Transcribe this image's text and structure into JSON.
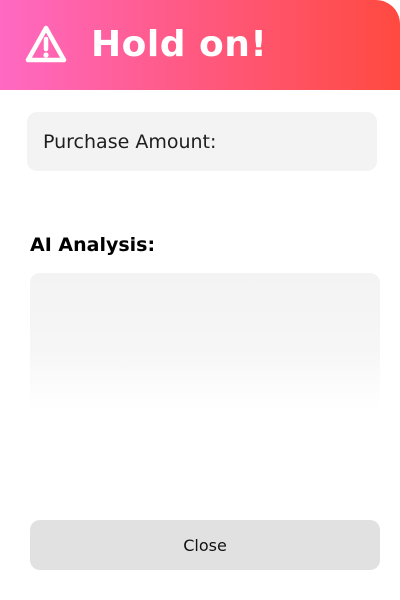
{
  "header": {
    "title": "Hold on!",
    "icon": "warning-triangle-icon",
    "gradient_start": "#ff69c3",
    "gradient_end": "#ff4a40"
  },
  "purchase": {
    "label": "Purchase Amount:"
  },
  "analysis": {
    "heading": "AI Analysis:",
    "content": ""
  },
  "footer": {
    "close_label": "Close"
  }
}
